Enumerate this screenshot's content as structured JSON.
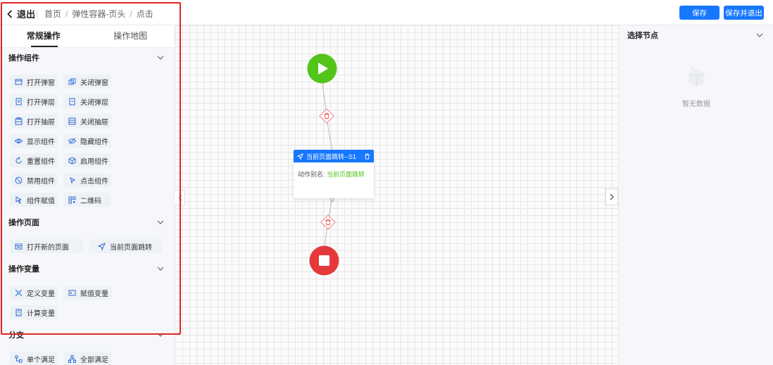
{
  "header": {
    "back_label": "退出",
    "breadcrumbs": [
      "首页",
      "弹性容器-页头",
      "点击"
    ],
    "save_label": "保存",
    "save_exit_label": "保存并退出"
  },
  "left_panel": {
    "tabs": [
      "常规操作",
      "操作地图"
    ],
    "sections": [
      {
        "title": "操作组件",
        "items": [
          {
            "label": "打开弹窗",
            "icon": "window-icon"
          },
          {
            "label": "关闭弹窗",
            "icon": "window-close-icon"
          },
          {
            "label": "打开弹层",
            "icon": "layer-icon"
          },
          {
            "label": "关闭弹层",
            "icon": "layer-close-icon"
          },
          {
            "label": "打开抽屉",
            "icon": "drawer-icon"
          },
          {
            "label": "关闭抽屉",
            "icon": "drawer-close-icon"
          },
          {
            "label": "显示组件",
            "icon": "eye-icon"
          },
          {
            "label": "隐藏组件",
            "icon": "eye-off-icon"
          },
          {
            "label": "重置组件",
            "icon": "reset-icon"
          },
          {
            "label": "启用组件",
            "icon": "box-icon"
          },
          {
            "label": "禁用组件",
            "icon": "ban-icon"
          },
          {
            "label": "点击组件",
            "icon": "click-icon"
          },
          {
            "label": "组件赋值",
            "icon": "assign-icon"
          },
          {
            "label": "二维码",
            "icon": "qrcode-icon"
          }
        ]
      },
      {
        "title": "操作页面",
        "items": [
          {
            "label": "打开新的页面",
            "icon": "page-icon"
          },
          {
            "label": "当前页面跳转",
            "icon": "send-icon"
          }
        ]
      },
      {
        "title": "操作变量",
        "items": [
          {
            "label": "定义变量",
            "icon": "define-icon"
          },
          {
            "label": "赋值变量",
            "icon": "terminal-icon"
          },
          {
            "label": "计算变量",
            "icon": "calculator-icon"
          }
        ]
      },
      {
        "title": "分支",
        "items": [
          {
            "label": "单个满足",
            "icon": "branch-single-icon"
          },
          {
            "label": "全部满足",
            "icon": "branch-all-icon"
          }
        ]
      }
    ]
  },
  "flow": {
    "node_title": "当前页面跳转--S1",
    "node_field_label": "动作别名:",
    "node_field_value": "当前页面跳转",
    "colors": {
      "start": "#52c41a",
      "end": "#e5383b",
      "accent": "#1677ff"
    }
  },
  "right_panel": {
    "title": "选择节点",
    "empty_text": "暂无数据"
  }
}
